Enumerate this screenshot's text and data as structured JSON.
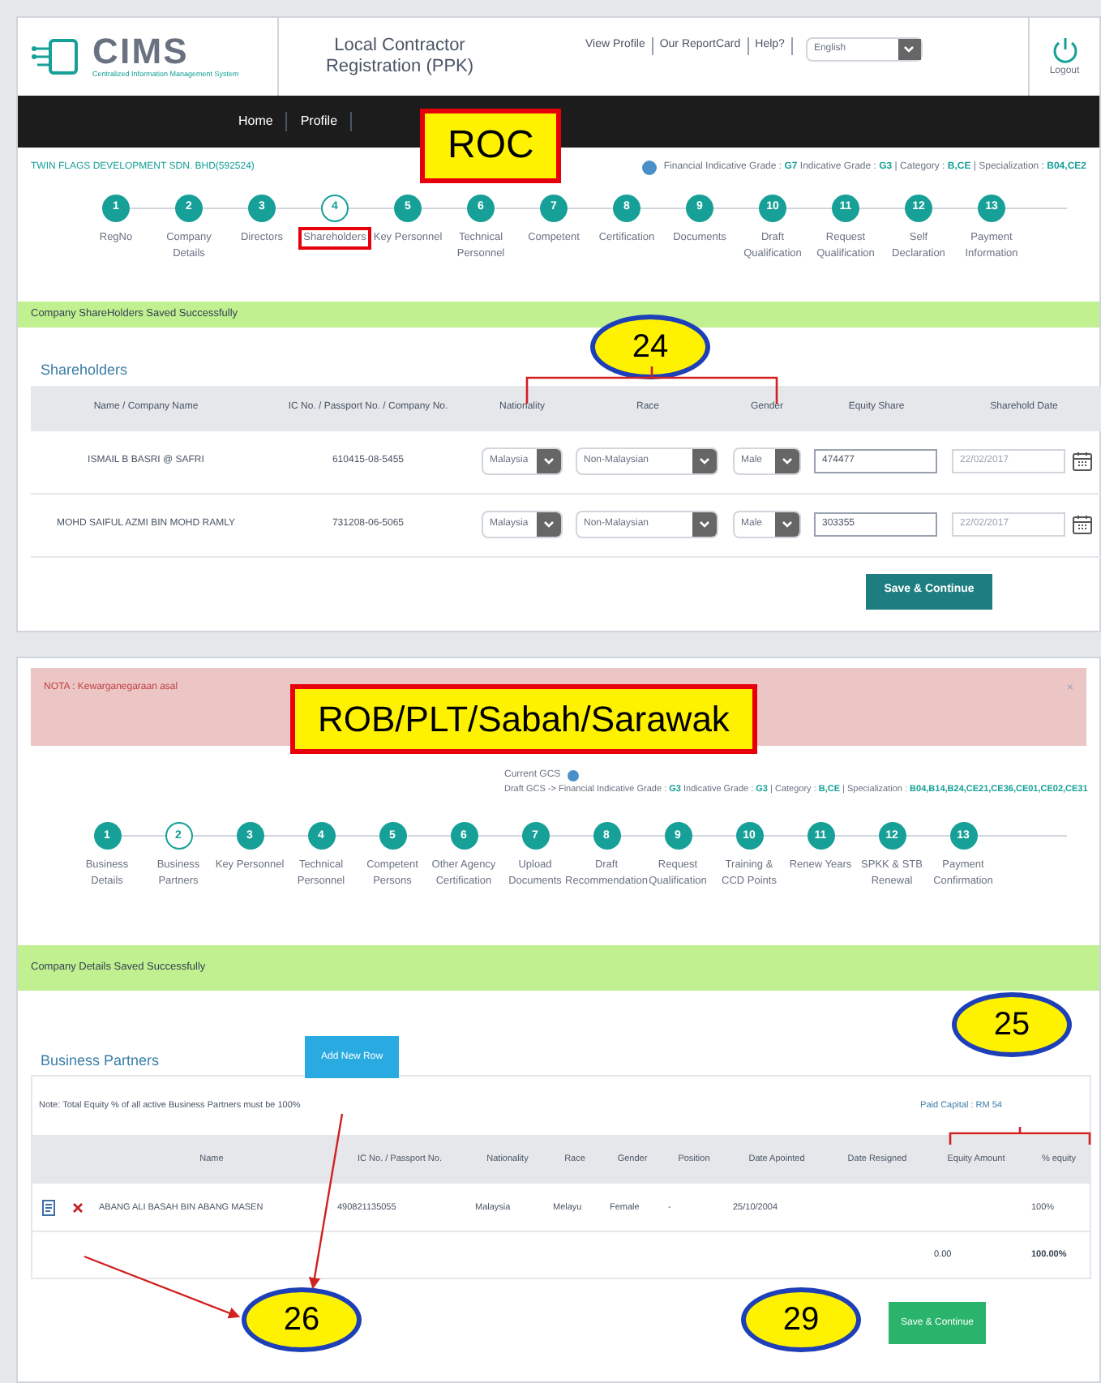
{
  "header": {
    "logo_title": "CIMS",
    "logo_subtitle": "Centralized Information Management System",
    "title": "Local Contractor Registration (PPK)",
    "links": [
      "View Profile",
      "Our ReportCard",
      "Help?"
    ],
    "language": "English",
    "logout": "Logout"
  },
  "nav": [
    "Home",
    "Profile"
  ],
  "roc": {
    "label": "ROC",
    "company": "TWIN FLAGS DEVELOPMENT SDN. BHD(592524)",
    "grades": "Financial Indicative Grade : **G7**  Indicative Grade : **G3** | Category : **B,CE** | Specialization : **B04,CE2**",
    "steps": [
      {
        "number": "1",
        "label": "RegNo",
        "selected": false
      },
      {
        "number": "2",
        "label": "Company Details",
        "selected": false
      },
      {
        "number": "3",
        "label": "Directors",
        "selected": false
      },
      {
        "number": "4",
        "label": "Shareholders",
        "selected": true
      },
      {
        "number": "5",
        "label": "Key Personnel",
        "selected": false
      },
      {
        "number": "6",
        "label": "Technical Personnel",
        "selected": false
      },
      {
        "number": "7",
        "label": "Competent",
        "selected": false
      },
      {
        "number": "8",
        "label": "Certification",
        "selected": false
      },
      {
        "number": "9",
        "label": "Documents",
        "selected": false
      },
      {
        "number": "10",
        "label": "Draft Qualification",
        "selected": false
      },
      {
        "number": "11",
        "label": "Request Qualification",
        "selected": false
      },
      {
        "number": "12",
        "label": "Self Declaration",
        "selected": false
      },
      {
        "number": "13",
        "label": "Payment Information",
        "selected": false
      }
    ],
    "message": "Company ShareHolders Saved Successfully",
    "callout": "24",
    "section": "Shareholders",
    "columns": [
      "Name / Company Name",
      "IC No. / Passport No. / Company No.",
      "Nationality",
      "Race",
      "Gender",
      "Equity Share",
      "Sharehold Date"
    ],
    "rows": [
      {
        "name": "ISMAIL B BASRI @ SAFRI",
        "ic": "610415-08-5455",
        "nationality": "Malaysia",
        "race": "Non-Malaysian",
        "gender": "Male",
        "equity": "474477",
        "date": "22/02/2017"
      },
      {
        "name": "MOHD SAIFUL AZMI BIN MOHD RAMLY",
        "ic": "731208-06-5065",
        "nationality": "Malaysia",
        "race": "Non-Malaysian",
        "gender": "Male",
        "equity": "303355",
        "date": "22/02/2017"
      }
    ],
    "save": "Save & Continue"
  },
  "rob": {
    "note": "NOTA : Kewarganegaraan asal",
    "close": "×",
    "label": "ROB/PLT/Sabah/Sarawak",
    "current_gcs": "Current GCS",
    "draft": "Draft GCS -> Financial Indicative Grade : **G3**  Indicative Grade : **G3** | Category : **B,CE** | Specialization : **B04,B14,B24,CE21,CE36,CE01,CE02,CE31**",
    "steps": [
      {
        "number": "1",
        "label": "Business Details",
        "selected": false
      },
      {
        "number": "2",
        "label": "Business Partners",
        "selected": true
      },
      {
        "number": "3",
        "label": "Key Personnel",
        "selected": false
      },
      {
        "number": "4",
        "label": "Technical Personnel",
        "selected": false
      },
      {
        "number": "5",
        "label": "Competent Persons",
        "selected": false
      },
      {
        "number": "6",
        "label": "Other Agency Certification",
        "selected": false
      },
      {
        "number": "7",
        "label": "Upload Documents",
        "selected": false
      },
      {
        "number": "8",
        "label": "Draft Recommendation",
        "selected": false
      },
      {
        "number": "9",
        "label": "Request Qualification",
        "selected": false
      },
      {
        "number": "10",
        "label": "Training & CCD Points",
        "selected": false
      },
      {
        "number": "11",
        "label": "Renew Years",
        "selected": false
      },
      {
        "number": "12",
        "label": "SPKK & STB Renewal",
        "selected": false
      },
      {
        "number": "13",
        "label": "Payment Confirmation",
        "selected": false
      }
    ],
    "message": "Company Details Saved Successfully",
    "section": "Business Partners",
    "add_button": "Add New Row",
    "equity_note": "Note: Total Equity % of all active Business Partners must be 100%",
    "paid_capital": "Paid Capital : RM 54",
    "columns": [
      "Name",
      "IC No. / Passport No.",
      "Nationality",
      "Race",
      "Gender",
      "Position",
      "Date Apointed",
      "Date Resigned",
      "Equity Amount",
      "% equity"
    ],
    "rows": [
      {
        "name": "ABANG ALI BASAH BIN ABANG MASEN",
        "ic": "490821135055",
        "nationality": "Malaysia",
        "race": "Melayu",
        "gender": "Female",
        "position": "-",
        "date_appointed": "25/10/2004",
        "equity_percent": "100%"
      }
    ],
    "totals": [
      "0.00",
      "100.00%"
    ],
    "save": "Save & Continue",
    "callouts": [
      "25",
      "26",
      "29"
    ]
  }
}
